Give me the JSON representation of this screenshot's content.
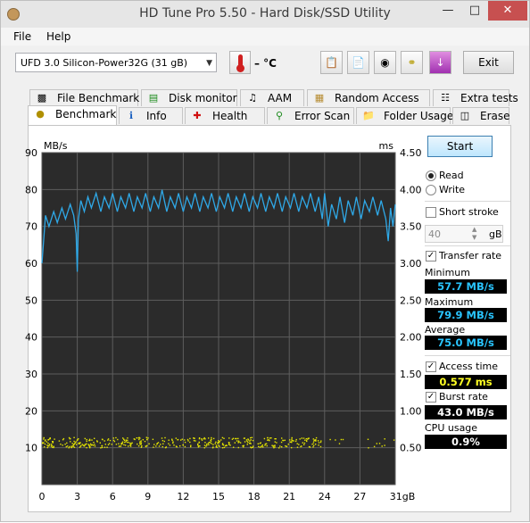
{
  "window": {
    "title": "HD Tune Pro 5.50 - Hard Disk/SSD Utility"
  },
  "menu": [
    "File",
    "Help"
  ],
  "toolbar": {
    "drive": "UFD 3.0 Silicon-Power32G (31 gB)",
    "temperature": "– °C",
    "exit_label": "Exit"
  },
  "tabs_top": [
    {
      "label": "File Benchmark",
      "icon": "file-benchmark-icon"
    },
    {
      "label": "Disk monitor",
      "icon": "disk-monitor-icon"
    },
    {
      "label": "AAM",
      "icon": "speaker-icon"
    },
    {
      "label": "Random Access",
      "icon": "random-access-icon"
    },
    {
      "label": "Extra tests",
      "icon": "extra-tests-icon"
    }
  ],
  "tabs_bottom": [
    {
      "label": "Benchmark",
      "icon": "benchmark-icon"
    },
    {
      "label": "Info",
      "icon": "info-icon"
    },
    {
      "label": "Health",
      "icon": "health-icon"
    },
    {
      "label": "Error Scan",
      "icon": "magnifier-icon"
    },
    {
      "label": "Folder Usage",
      "icon": "folder-icon"
    },
    {
      "label": "Erase",
      "icon": "trash-icon"
    }
  ],
  "panel": {
    "start": "Start",
    "read": "Read",
    "write": "Write",
    "short_stroke": "Short stroke",
    "short_stroke_value": "40",
    "short_stroke_unit": "gB",
    "transfer_rate": "Transfer rate",
    "minimum_label": "Minimum",
    "minimum": "57.7 MB/s",
    "maximum_label": "Maximum",
    "maximum": "79.9 MB/s",
    "average_label": "Average",
    "average": "75.0 MB/s",
    "access_time_label": "Access time",
    "access_time": "0.577 ms",
    "burst_rate_label": "Burst rate",
    "burst_rate": "43.0 MB/s",
    "cpu_usage_label": "CPU usage",
    "cpu_usage": "0.9%"
  },
  "chart_data": {
    "type": "line",
    "ylabel_left": "MB/s",
    "ylabel_right": "ms",
    "xlabel": "gB",
    "x_ticks": [
      "0",
      "3",
      "6",
      "9",
      "12",
      "15",
      "18",
      "21",
      "24",
      "27",
      "31gB"
    ],
    "y_ticks_left": [
      "90",
      "80",
      "70",
      "60",
      "50",
      "40",
      "30",
      "20",
      "10"
    ],
    "y_ticks_right": [
      "4.50",
      "4.00",
      "3.50",
      "3.00",
      "2.50",
      "2.00",
      "1.50",
      "1.00",
      "0.50"
    ],
    "xlim": [
      0,
      30
    ],
    "ylim_left": [
      0,
      90
    ],
    "ylim_right": [
      0,
      4.5
    ],
    "grid": true,
    "series": [
      {
        "color": "#2fa9e8",
        "x": [
          0,
          0.3,
          0.6,
          1.0,
          1.3,
          1.7,
          2.0,
          2.4,
          2.7,
          2.9,
          3.0,
          3.1,
          3.3,
          3.6,
          3.9,
          4.2,
          4.6,
          5.0,
          5.3,
          5.7,
          6.0,
          6.4,
          6.7,
          7.1,
          7.4,
          7.8,
          8.1,
          8.5,
          8.8,
          9.2,
          9.5,
          9.9,
          10.2,
          10.6,
          10.9,
          11.3,
          11.6,
          12.0,
          12.3,
          12.7,
          13.0,
          13.4,
          13.7,
          14.1,
          14.4,
          14.8,
          15.1,
          15.5,
          15.8,
          16.2,
          16.5,
          16.9,
          17.2,
          17.6,
          17.9,
          18.3,
          18.6,
          19.0,
          19.3,
          19.7,
          20.0,
          20.4,
          20.7,
          21.1,
          21.4,
          21.8,
          22.1,
          22.5,
          22.8,
          23.2,
          23.5,
          23.8,
          24.0,
          24.3,
          24.6,
          25.0,
          25.3,
          25.7,
          26.0,
          26.4,
          26.7,
          27.1,
          27.4,
          27.8,
          28.1,
          28.5,
          28.8,
          29.2,
          29.4,
          29.6,
          29.8,
          30.0
        ],
        "values": [
          60,
          73,
          70,
          74,
          71,
          75,
          72,
          76,
          73,
          68,
          57.7,
          72,
          77,
          74,
          78,
          75,
          79,
          74,
          78,
          75,
          79,
          74,
          78,
          75,
          79,
          74,
          78,
          75,
          79,
          74,
          78,
          75,
          79.9,
          74,
          78,
          75,
          79,
          74,
          78,
          75,
          79,
          74,
          78,
          75,
          79,
          74,
          78,
          75,
          79,
          74,
          78,
          75,
          79,
          74,
          78,
          75,
          79,
          74,
          78,
          75,
          79,
          74,
          78,
          75,
          79,
          74,
          78,
          75,
          79,
          74,
          78,
          72,
          79,
          70,
          76,
          72,
          78,
          71,
          77,
          73,
          78,
          72,
          77,
          74,
          78,
          73,
          77,
          72,
          66,
          75,
          70,
          76
        ]
      }
    ],
    "access_time_band": {
      "color": "#e6e600",
      "x_range": [
        0,
        30
      ],
      "value_ms": 0.577
    }
  }
}
